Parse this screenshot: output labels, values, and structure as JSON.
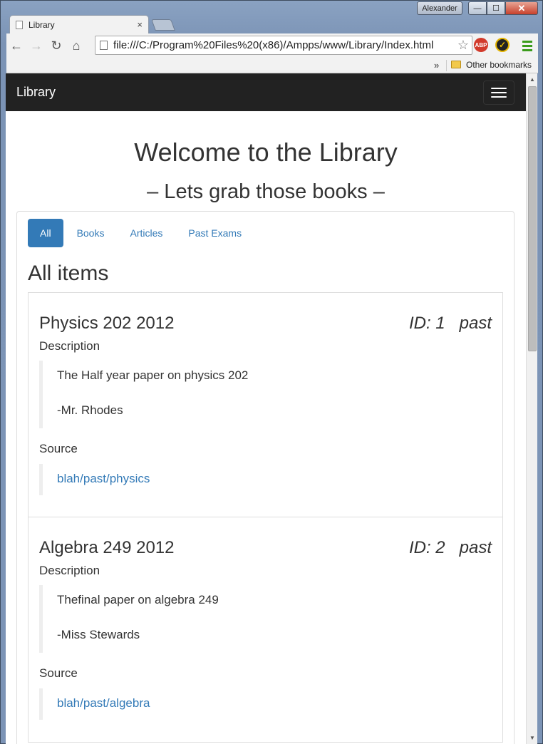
{
  "window": {
    "user": "Alexander",
    "min": "—",
    "max": "☐",
    "close": "✕"
  },
  "tab": {
    "title": "Library",
    "close": "×"
  },
  "toolbar": {
    "url": "file:///C:/Program%20Files%20(x86)/Ampps/www/Library/Index.html",
    "back": "←",
    "forward": "→",
    "reload": "↻",
    "home": "⌂",
    "star": "☆",
    "abp": "ABP",
    "check": "✓"
  },
  "bookmarks": {
    "more": "»",
    "other": "Other bookmarks"
  },
  "navbar": {
    "brand": "Library"
  },
  "header": {
    "title": "Welcome to the Library",
    "subtitle": "– Lets grab those books –"
  },
  "pills": [
    {
      "label": "All",
      "active": true
    },
    {
      "label": "Books"
    },
    {
      "label": "Articles"
    },
    {
      "label": "Past Exams"
    }
  ],
  "section_title": "All items",
  "labels": {
    "description": "Description",
    "source": "Source"
  },
  "items": [
    {
      "title": "Physics 202 2012",
      "id": "ID: 1",
      "type": "past",
      "description": "The Half year paper on physics 202",
      "author": "-Mr. Rhodes",
      "source": "blah/past/physics"
    },
    {
      "title": "Algebra 249 2012",
      "id": "ID: 2",
      "type": "past",
      "description": "Thefinal paper on algebra 249",
      "author": "-Miss Stewards",
      "source": "blah/past/algebra"
    }
  ],
  "scroll": {
    "up": "▲",
    "down": "▼"
  }
}
